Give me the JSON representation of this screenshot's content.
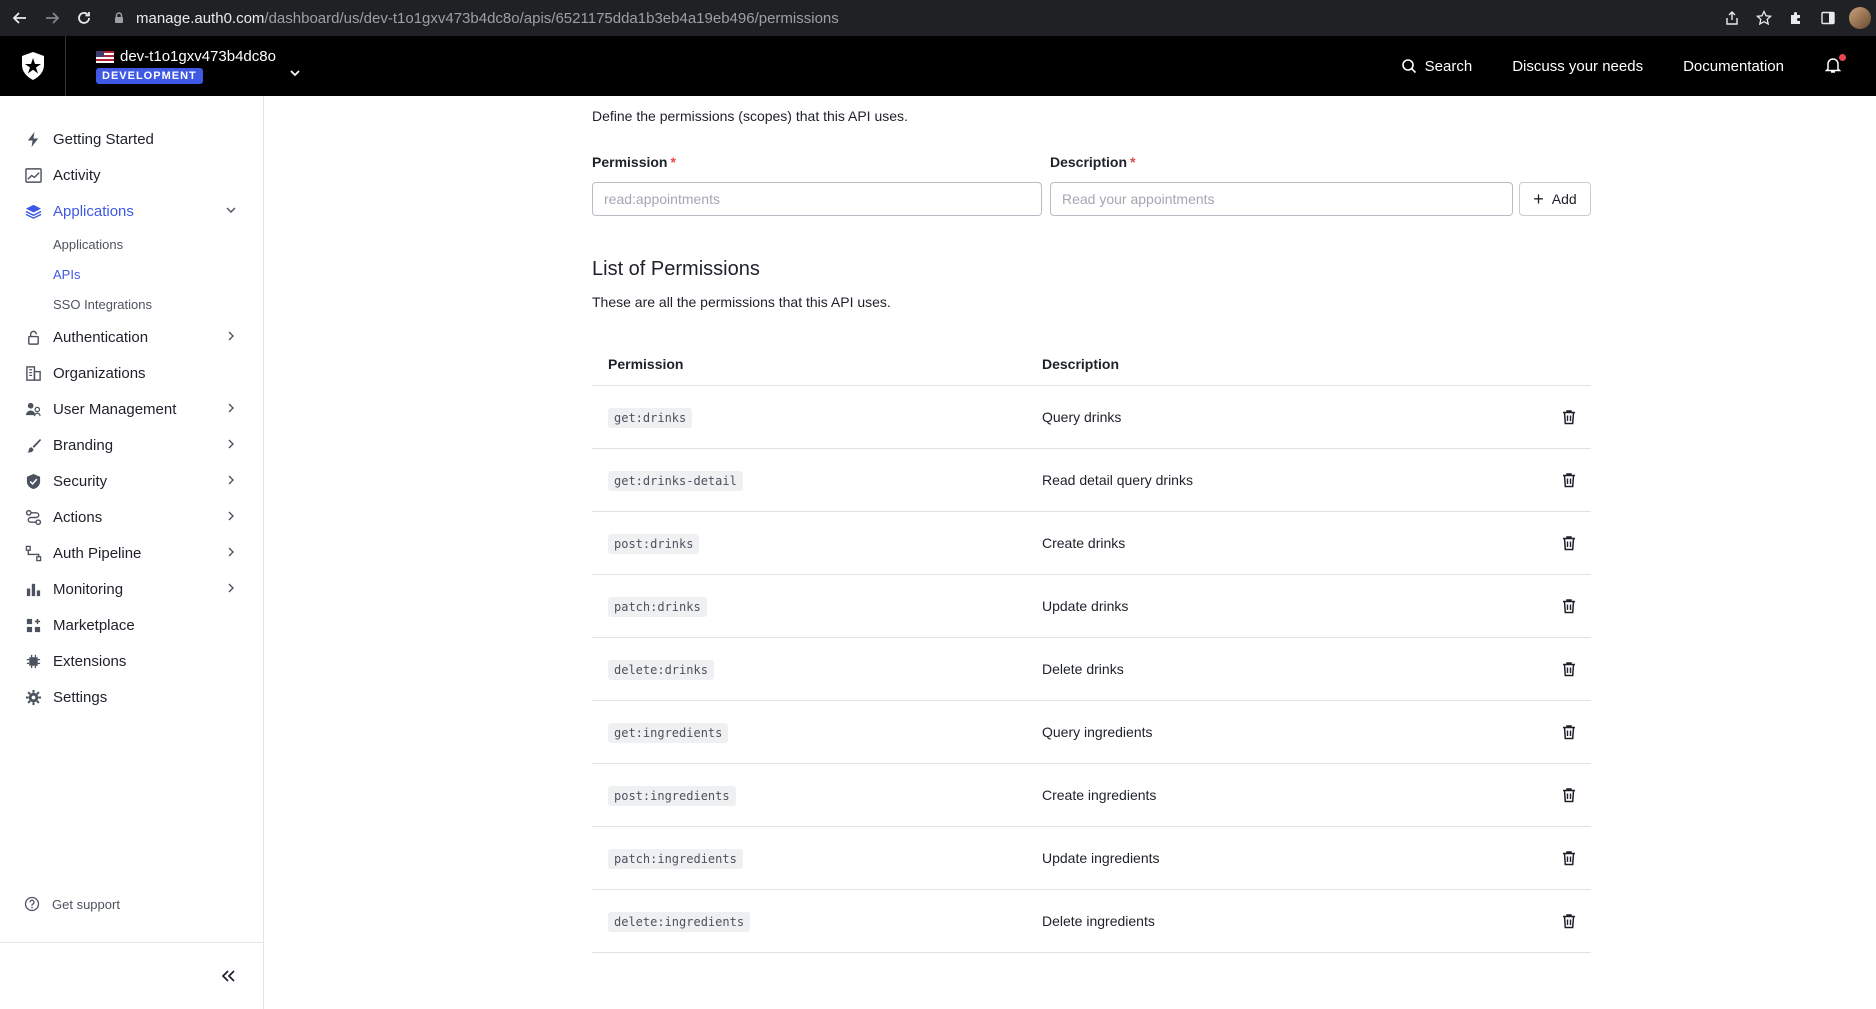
{
  "browser": {
    "url_host": "manage.auth0.com",
    "url_path": "/dashboard/us/dev-t1o1gxv473b4dc8o/apis/6521175dda1b3eb4a19eb496/permissions"
  },
  "header": {
    "tenant_name": "dev-t1o1gxv473b4dc8o",
    "environment": "DEVELOPMENT",
    "search_label": "Search",
    "discuss_label": "Discuss your needs",
    "docs_label": "Documentation"
  },
  "sidebar": {
    "items": [
      {
        "label": "Getting Started",
        "icon": "bolt-icon"
      },
      {
        "label": "Activity",
        "icon": "chart-line-icon"
      },
      {
        "label": "Applications",
        "icon": "layers-icon",
        "active": true,
        "expanded": true
      },
      {
        "label": "Authentication",
        "icon": "lock-icon"
      },
      {
        "label": "Organizations",
        "icon": "building-icon"
      },
      {
        "label": "User Management",
        "icon": "users-icon"
      },
      {
        "label": "Branding",
        "icon": "brush-icon"
      },
      {
        "label": "Security",
        "icon": "shield-icon"
      },
      {
        "label": "Actions",
        "icon": "flow-icon"
      },
      {
        "label": "Auth Pipeline",
        "icon": "pipeline-icon"
      },
      {
        "label": "Monitoring",
        "icon": "bar-chart-icon"
      },
      {
        "label": "Marketplace",
        "icon": "grid-plus-icon"
      },
      {
        "label": "Extensions",
        "icon": "chip-icon"
      },
      {
        "label": "Settings",
        "icon": "gear-icon"
      }
    ],
    "sub_items": [
      {
        "label": "Applications"
      },
      {
        "label": "APIs",
        "active": true
      },
      {
        "label": "SSO Integrations"
      }
    ],
    "support_label": "Get support"
  },
  "main": {
    "intro": "Define the permissions (scopes) that this API uses.",
    "permission_label": "Permission",
    "description_label": "Description",
    "required_mark": "*",
    "permission_placeholder": "read:appointments",
    "description_placeholder": "Read your appointments",
    "add_label": "Add",
    "list_title": "List of Permissions",
    "list_subtitle": "These are all the permissions that this API uses.",
    "table": {
      "col_permission": "Permission",
      "col_description": "Description",
      "rows": [
        {
          "permission": "get:drinks",
          "description": "Query drinks"
        },
        {
          "permission": "get:drinks-detail",
          "description": "Read detail query drinks"
        },
        {
          "permission": "post:drinks",
          "description": "Create drinks"
        },
        {
          "permission": "patch:drinks",
          "description": "Update drinks"
        },
        {
          "permission": "delete:drinks",
          "description": "Delete drinks"
        },
        {
          "permission": "get:ingredients",
          "description": "Query ingredients"
        },
        {
          "permission": "post:ingredients",
          "description": "Create ingredients"
        },
        {
          "permission": "patch:ingredients",
          "description": "Update ingredients"
        },
        {
          "permission": "delete:ingredients",
          "description": "Delete ingredients"
        }
      ]
    }
  },
  "colors": {
    "accent": "#3f59e4",
    "required": "#e5484d"
  }
}
